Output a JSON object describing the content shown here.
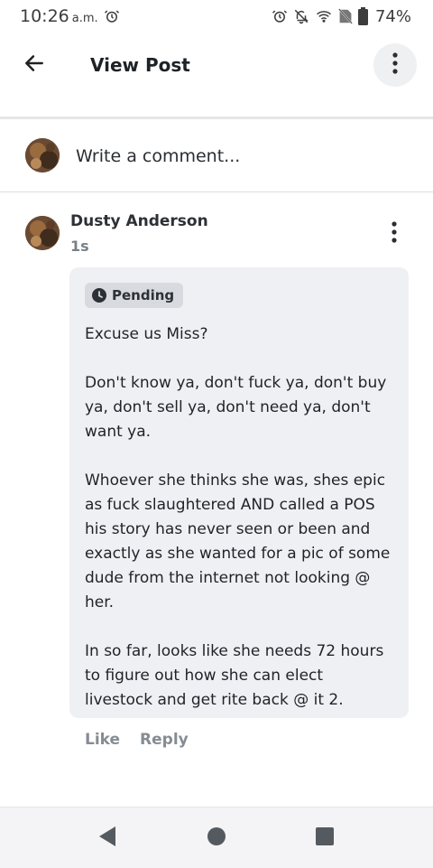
{
  "status_bar": {
    "time": "10:26",
    "ampm": "a.m.",
    "battery_percent": "74%",
    "icons": [
      "alarm-icon",
      "alarm-icon",
      "notifications-off-icon",
      "wifi-icon",
      "no-sim-icon",
      "battery-icon"
    ]
  },
  "header": {
    "title": "View Post",
    "back_icon": "arrow-left-icon",
    "menu_icon": "more-vertical-icon"
  },
  "comment_box": {
    "placeholder": "Write a comment..."
  },
  "post": {
    "author": "Dusty Anderson",
    "time": "1s",
    "status_badge": "Pending",
    "body": "Excuse us Miss?\n\nDon't know ya, don't fuck ya, don't buy ya, don't sell ya, don't need ya, don't want ya.\n\nWhoever she thinks she was, shes epic as fuck slaughtered AND called a POS his story has never seen or been and exactly as she wanted for a pic of some dude from the internet not looking @ her.\n\nIn so far, looks like she needs 72 hours to figure out how she can elect livestock and get rite back @ it 2.",
    "actions": {
      "like": "Like",
      "reply": "Reply"
    }
  },
  "colors": {
    "accent_text": "#1d2226",
    "muted_text": "#868c93",
    "bubble_bg": "#eff0f3",
    "badge_bg": "#d8dadf"
  },
  "nav": {
    "icons": [
      "back-triangle-icon",
      "home-circle-icon",
      "recents-square-icon"
    ]
  }
}
